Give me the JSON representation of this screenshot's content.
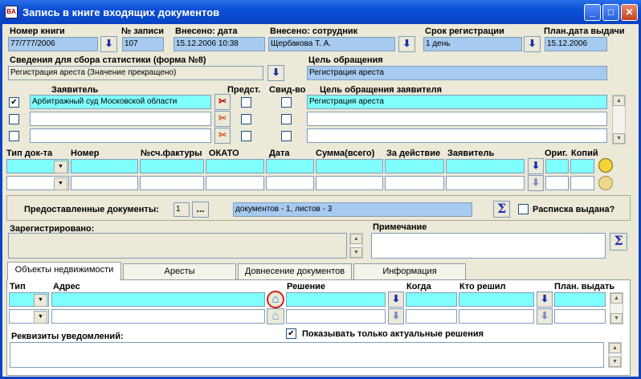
{
  "window": {
    "title": "Запись в книге входящих документов",
    "app_icon_text": "BA",
    "minimize_glyph": "_",
    "maximize_glyph": "□",
    "close_glyph": "✕"
  },
  "header": {
    "book_number_label": "Номер книги",
    "book_number_value": "77/777/2006",
    "record_number_label": "№ записи",
    "record_number_value": "107",
    "entered_date_label": "Внесено: дата",
    "entered_date_value": "15.12.2006 10:38",
    "entered_by_label": "Внесено: сотрудник",
    "entered_by_value": "Щербакова Т. А.",
    "reg_term_label": "Срок регистрации",
    "reg_term_value": "1 день",
    "plan_date_label": "План.дата выдачи",
    "plan_date_value": "15.12.2006"
  },
  "statistics": {
    "label": "Сведения для сбора статистики (форма №8)",
    "value": "Регистрация ареста (Значение прекращено)",
    "purpose_label": "Цель обращения",
    "purpose_value": "Регистрация ареста"
  },
  "applicants": {
    "applicant_label": "Заявитель",
    "rep_label": "Предст.",
    "cert_label": "Свид-во",
    "purpose_label": "Цель обращения заявителя",
    "rows": [
      {
        "checked": "✔",
        "name": "Арбитражный суд Московской области",
        "purpose": "Регистрация ареста"
      },
      {
        "checked": "",
        "name": "",
        "purpose": ""
      },
      {
        "checked": "",
        "name": "",
        "purpose": ""
      }
    ]
  },
  "documents": {
    "headers": [
      "Тип док-та",
      "Номер",
      "№сч.фактуры",
      "ОКАТО",
      "Дата",
      "Сумма(всего)",
      "За действие",
      "Заявитель",
      "Ориг.",
      "Копий"
    ]
  },
  "provided": {
    "label": "Предоставленные документы:",
    "count": "1",
    "browse_label": "...",
    "summary": "документов - 1, листов - 3",
    "receipt_label": "Расписка выдана?"
  },
  "registered": {
    "label": "Зарегистрировано:",
    "note_label": "Примечание"
  },
  "tabs": [
    {
      "label": "Объекты недвижимости",
      "active": true
    },
    {
      "label": "Аресты",
      "active": false
    },
    {
      "label": "Довнесение документов",
      "active": false
    },
    {
      "label": "Информация",
      "active": false
    }
  ],
  "objects": {
    "type_label": "Тип",
    "address_label": "Адрес",
    "decision_label": "Решение",
    "when_label": "Когда",
    "who_label": "Кто решил",
    "plan_label": "План. выдать",
    "show_actual_label": "Показывать только актуальные решения",
    "show_actual_checked": "✔",
    "notif_label": "Реквизиты уведомлений:"
  },
  "icons": {
    "down_arrow": "⬇",
    "sigma": "Σ",
    "dropdown": "▼",
    "scroll_up": "▲",
    "scroll_down": "▼",
    "remove": "✂",
    "house": "⌂"
  },
  "colors": {
    "titlebar": "#0b4fd6",
    "field_cyan": "#80ffff",
    "field_blue": "#a6caf0",
    "window_bg": "#ece9d8"
  }
}
